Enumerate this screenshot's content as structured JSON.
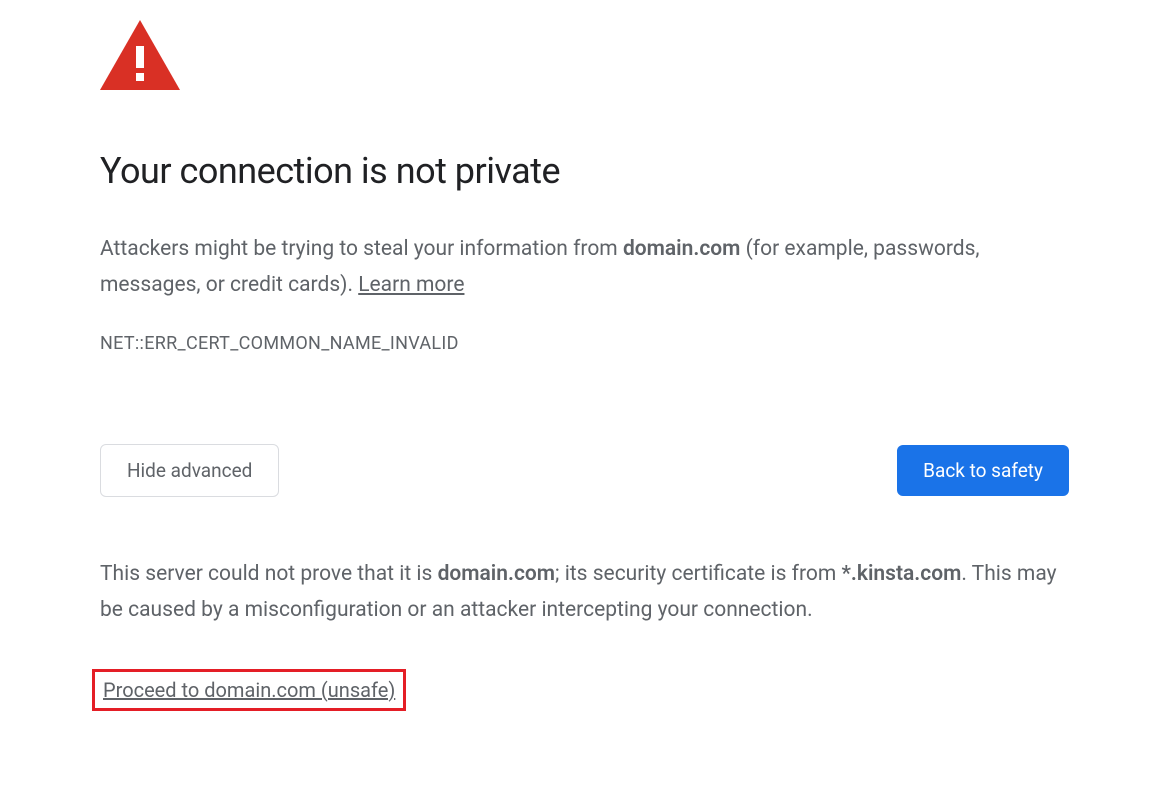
{
  "heading": "Your connection is not private",
  "description": {
    "prefix": "Attackers might be trying to steal your information from ",
    "domain": "domain.com",
    "suffix": " (for example, passwords, messages, or credit cards). ",
    "learn_more": "Learn more"
  },
  "error_code": "NET::ERR_CERT_COMMON_NAME_INVALID",
  "buttons": {
    "hide_advanced": "Hide advanced",
    "back_to_safety": "Back to safety"
  },
  "details": {
    "prefix": "This server could not prove that it is ",
    "domain": "domain.com",
    "middle": "; its security certificate is from ",
    "cert_domain": "*.kinsta.com",
    "suffix": ". This may be caused by a misconfiguration or an attacker intercepting your connection."
  },
  "proceed_link": "Proceed to domain.com (unsafe)",
  "colors": {
    "danger_red": "#d93025",
    "primary_blue": "#1a73e8",
    "highlight_red": "#e41e26",
    "text_gray": "#5f6368",
    "text_dark": "#202124"
  }
}
